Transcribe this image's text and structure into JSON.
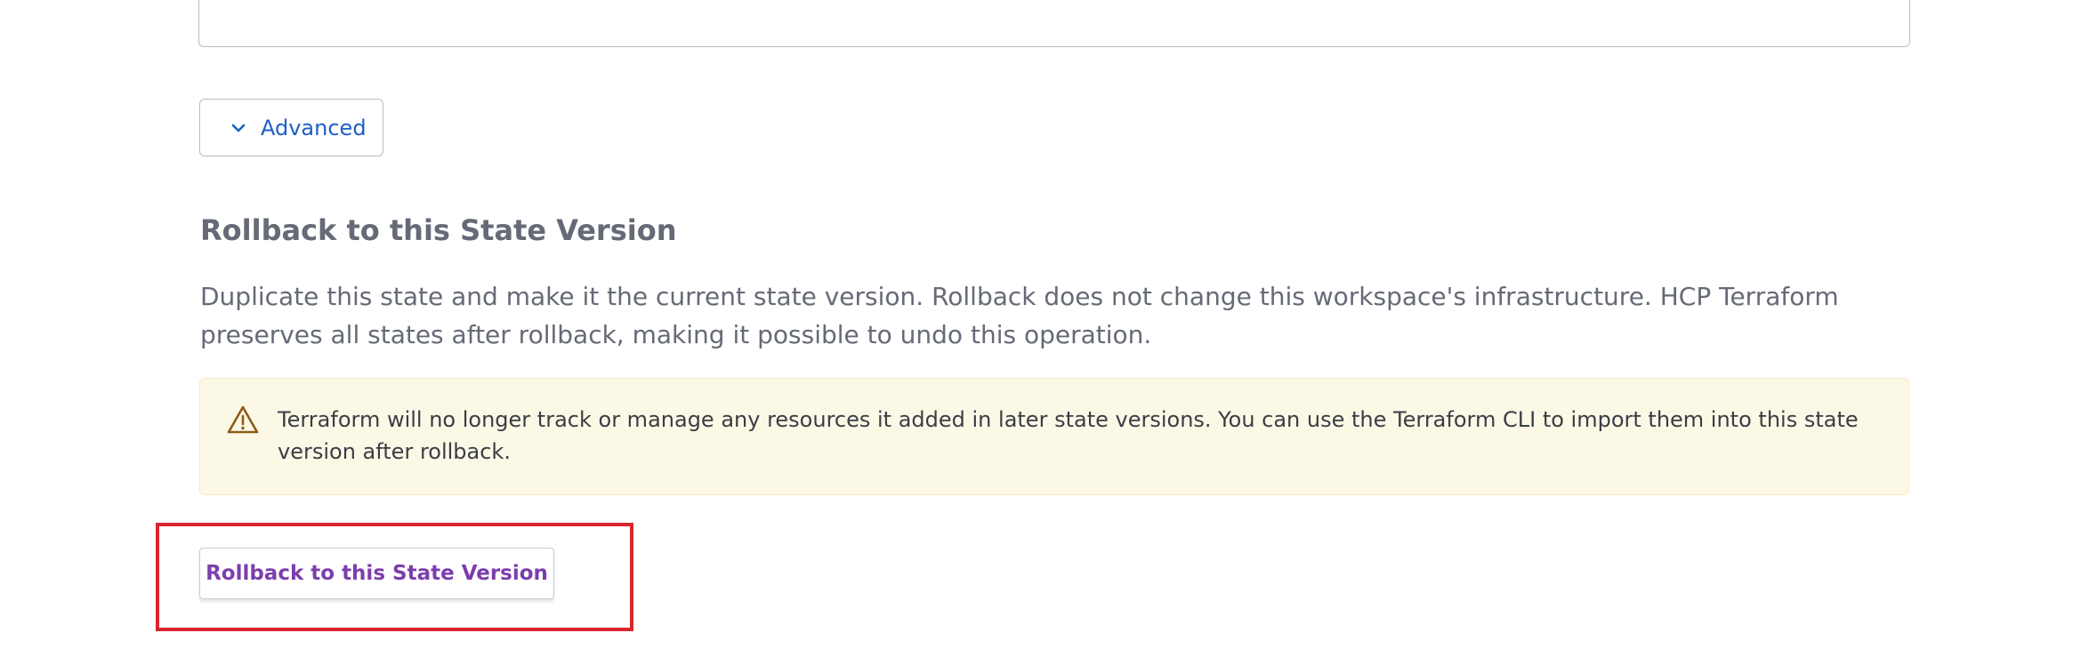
{
  "advanced": {
    "label": "Advanced",
    "icon": "chevron-down-icon"
  },
  "rollback_section": {
    "heading": "Rollback to this State Version",
    "description": "Duplicate this state and make it the current state version. Rollback does not change this workspace's infrastructure. HCP Terraform preserves all states after rollback, making it possible to undo this operation.",
    "warning": {
      "icon": "warning-triangle-icon",
      "text": "Terraform will no longer track or manage any resources it added in later state versions. You can use the Terraform CLI to import them into this state version after rollback."
    },
    "button_label": "Rollback to this State Version"
  },
  "colors": {
    "link_blue": "#1d5fc4",
    "heading_gray": "#656a76",
    "warning_bg": "#fcf8e6",
    "warning_icon": "#8d5c1a",
    "button_purple": "#7b3ead",
    "highlight_red": "#d9262e"
  }
}
